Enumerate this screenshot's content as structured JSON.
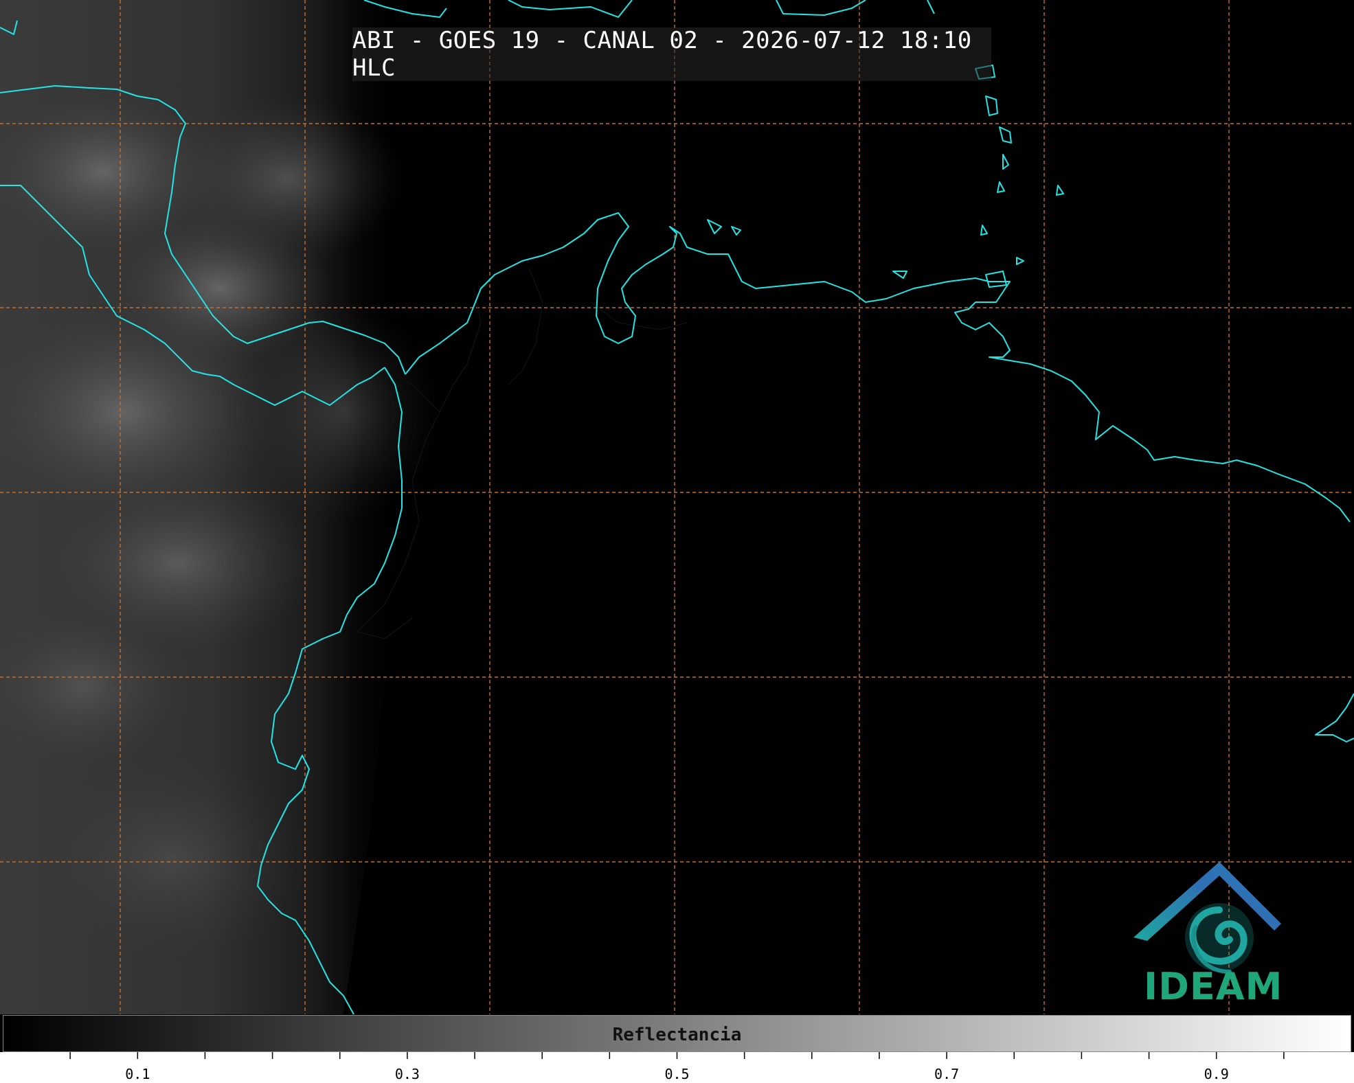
{
  "title": "ABI - GOES 19 - CANAL 02 - 2026-07-12 18:10 HLC",
  "colorbar": {
    "label": "Reflectancia",
    "min": 0.0,
    "max": 1.0,
    "tick_labels": [
      "0.1",
      "0.3",
      "0.5",
      "0.7",
      "0.9"
    ],
    "tick_values": [
      0.1,
      0.3,
      0.5,
      0.7,
      0.9
    ],
    "minor_step": 0.05
  },
  "logo": {
    "text": "IDEAM",
    "color": "#1fa67a"
  },
  "colors": {
    "coastline": "#22e5e5",
    "grid": "#c8702a",
    "background": "#000000"
  }
}
